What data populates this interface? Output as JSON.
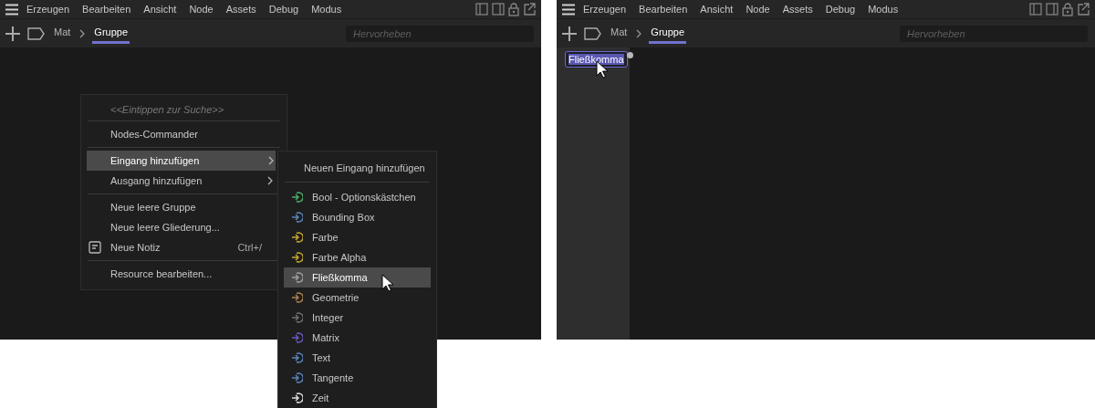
{
  "panels": [
    {
      "menubar": [
        "Erzeugen",
        "Bearbeiten",
        "Ansicht",
        "Node",
        "Assets",
        "Debug",
        "Modus"
      ],
      "breadcrumb": [
        {
          "label": "Mat",
          "selected": false
        },
        {
          "label": "Gruppe",
          "selected": true
        }
      ],
      "search": {
        "placeholder": "Hervorheben"
      },
      "context_menu": {
        "items": [
          {
            "kind": "search",
            "label": "<<Eintippen zur Suche>>"
          },
          {
            "kind": "separator"
          },
          {
            "kind": "item",
            "label": "Nodes-Commander",
            "selected": false,
            "has_submenu": false
          },
          {
            "kind": "separator"
          },
          {
            "kind": "item",
            "label": "Eingang hinzufügen",
            "selected": true,
            "has_submenu": true
          },
          {
            "kind": "item",
            "label": "Ausgang hinzufügen",
            "selected": false,
            "has_submenu": true
          },
          {
            "kind": "separator"
          },
          {
            "kind": "item",
            "label": "Neue leere Gruppe",
            "selected": false,
            "has_submenu": false
          },
          {
            "kind": "item",
            "label": "Neue leere Gliederung...",
            "selected": false,
            "has_submenu": false
          },
          {
            "kind": "note",
            "label": "Neue Notiz",
            "shortcut": "Ctrl+/",
            "selected": false,
            "has_submenu": false
          },
          {
            "kind": "separator"
          },
          {
            "kind": "item",
            "label": "Resource bearbeiten...",
            "selected": false,
            "has_submenu": false
          }
        ]
      },
      "submenu": {
        "header": "Neuen Eingang hinzufügen",
        "items": [
          {
            "label": "Bool - Optionskästchen",
            "color": "#4caf6a",
            "selected": false
          },
          {
            "label": "Bounding Box",
            "color": "#5b86c0",
            "selected": false
          },
          {
            "label": "Farbe",
            "color": "#c8a832",
            "selected": false
          },
          {
            "label": "Farbe Alpha",
            "color": "#c8a832",
            "selected": false
          },
          {
            "label": "Fließkomma",
            "color": "#a0a0a0",
            "selected": true
          },
          {
            "label": "Geometrie",
            "color": "#b08450",
            "selected": false
          },
          {
            "label": "Integer",
            "color": "#707070",
            "selected": false
          },
          {
            "label": "Matrix",
            "color": "#6a5cc0",
            "selected": false
          },
          {
            "label": "Text",
            "color": "#5b86c0",
            "selected": false
          },
          {
            "label": "Tangente",
            "color": "#5b86c0",
            "selected": false
          },
          {
            "label": "Zeit",
            "color": "#e0e0e0",
            "selected": false
          }
        ]
      }
    },
    {
      "menubar": [
        "Erzeugen",
        "Bearbeiten",
        "Ansicht",
        "Node",
        "Assets",
        "Debug",
        "Modus"
      ],
      "breadcrumb": [
        {
          "label": "Mat",
          "selected": false
        },
        {
          "label": "Gruppe",
          "selected": true
        }
      ],
      "search": {
        "placeholder": "Hervorheben"
      },
      "port_editor": {
        "value": "Fließkomma",
        "selected": true
      }
    }
  ]
}
